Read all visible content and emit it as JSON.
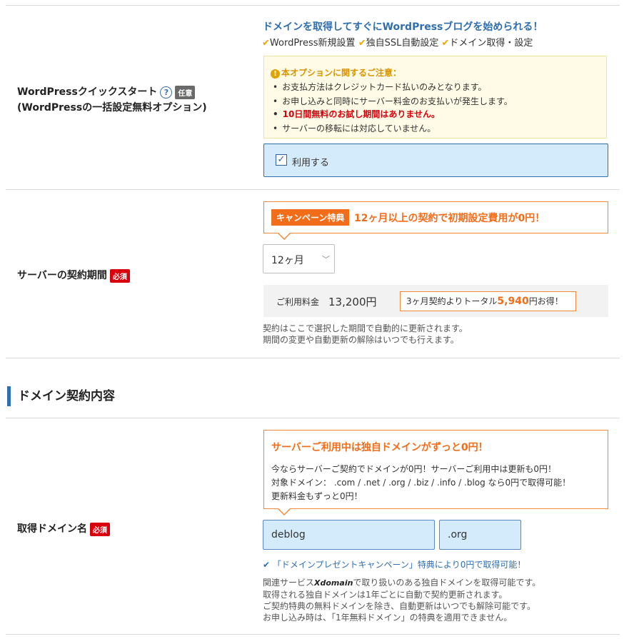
{
  "wp": {
    "label": "WordPressクイックスタート",
    "help": "?",
    "optional_badge": "任意",
    "sublabel": "(WordPressの一括設定無料オプション)",
    "headline": "ドメインを取得してすぐにWordPressブログを始められる！",
    "features": [
      "WordPress新規設置",
      "独自SSL自動設定",
      "ドメイン取得・設定"
    ],
    "notice_title": "本オプションに関するご注意：",
    "notice_items": [
      "お支払方法はクレジットカード払いのみとなります。",
      "お申し込みと同時にサーバー料金のお支払いが発生します。",
      "10日間無料のお試し期間はありません。",
      "サーバーの移転には対応していません。"
    ],
    "use_label": "利用する"
  },
  "period": {
    "label": "サーバーの契約期間",
    "required_badge": "必須",
    "campaign_tag": "キャンペーン特典",
    "campaign_text": "12ヶ月以上の契約で初期設定費用が0円！",
    "select_value": "12ヶ月",
    "price_label": "ご利用料金",
    "price_value": "13,200円",
    "save_prefix": "3ヶ月契約よりトータル",
    "save_amount": "5,940",
    "save_suffix": "円お得！",
    "note1": "契約はここで選択した期間で自動的に更新されます。",
    "note2": "期間の変更や自動更新の解除はいつでも行えます。"
  },
  "domain_section": {
    "title": "ドメイン契約内容"
  },
  "domain": {
    "label": "取得ドメイン名",
    "required_badge": "必須",
    "promo_title": "サーバーご利用中は独自ドメインがずっと0円！",
    "promo_line1": "今ならサーバーご契約でドメインが0円！サーバーご利用中は更新も0円！",
    "promo_line2": "対象ドメイン： .com / .net / .org / .biz / .info / .blog なら0円で取得可能！",
    "promo_line3": "更新料金もずっと0円！",
    "name_value": "deblog",
    "tld_value": ".org",
    "present_text": "「ドメインプレゼントキャンペーン」特典により0円で取得可能！",
    "note1_prefix": "関連サービス",
    "xdomain_logo": "Xdomain",
    "note1_suffix": "で取り扱いのある独自ドメインを取得可能です。",
    "note2": "取得される独自ドメインは1年ごとに自動で契約更新されます。",
    "note3": "ご契約特典の無料ドメインを除き、自動更新はいつでも解除可能です。",
    "note4": "お申し込み時は、「1年無料ドメイン」の特典を適用できません。"
  },
  "colors": {
    "accent_orange": "#f26d1a",
    "required_red": "#d8000c",
    "blue": "#2f6fb0",
    "check_yellow": "#f0a400"
  }
}
